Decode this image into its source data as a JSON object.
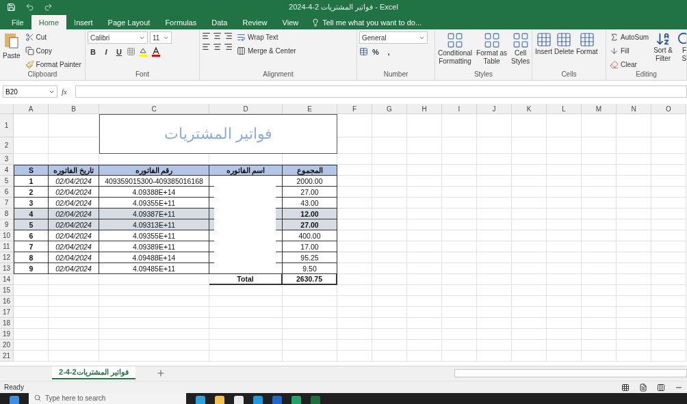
{
  "window": {
    "title": "فواتير المشتريات 2-4-2024 - Excel"
  },
  "tabs": [
    {
      "label": "File",
      "selected": false
    },
    {
      "label": "Home",
      "selected": true
    },
    {
      "label": "Insert",
      "selected": false
    },
    {
      "label": "Page Layout",
      "selected": false
    },
    {
      "label": "Formulas",
      "selected": false
    },
    {
      "label": "Data",
      "selected": false
    },
    {
      "label": "Review",
      "selected": false
    },
    {
      "label": "View",
      "selected": false
    }
  ],
  "tell_me": "Tell me what you want to do...",
  "ribbon": {
    "clipboard": {
      "paste": "Paste",
      "cut": "Cut",
      "copy": "Copy",
      "format_painter": "Format Painter",
      "label": "Clipboard"
    },
    "font": {
      "name": "Calibri",
      "size": "11",
      "bold": "B",
      "italic": "I",
      "underline": "U",
      "label": "Font"
    },
    "alignment": {
      "wrap_text": "Wrap Text",
      "merge_center": "Merge & Center",
      "label": "Alignment"
    },
    "number": {
      "format": "General",
      "percent": "%",
      "comma": ",",
      "label": "Number"
    },
    "styles": {
      "conditional": [
        "Conditional",
        "Formatting"
      ],
      "format_table": [
        "Format as",
        "Table"
      ],
      "cell_styles": [
        "Cell",
        "Styles"
      ],
      "label": "Styles"
    },
    "cells": {
      "insert": "Insert",
      "delete": "Delete",
      "format": "Format",
      "label": "Cells"
    },
    "editing": {
      "autosum": "AutoSum",
      "fill": "Fill",
      "clear": "Clear",
      "sort": [
        "Sort &",
        "Filter"
      ],
      "find": [
        "F",
        "S"
      ],
      "label": "Editing"
    }
  },
  "formula_bar": {
    "name_box": "B20",
    "fx": "fx"
  },
  "sheet": {
    "columns": [
      "A",
      "B",
      "C",
      "D",
      "E",
      "F",
      "G",
      "H",
      "I",
      "J",
      "K",
      "L",
      "M",
      "N",
      "O"
    ],
    "row_numbers": [
      "1",
      "2",
      "3",
      "4",
      "5",
      "6",
      "7",
      "8",
      "9",
      "10",
      "11",
      "12",
      "13",
      "14",
      "15",
      "16",
      "17",
      "18",
      "19",
      "20",
      "21"
    ],
    "title": "فواتير المشتريات",
    "header": {
      "s": "S",
      "date": "تاريخ الفاتوره",
      "number": "رقم الفاتوره",
      "name": "اسم الفاتوره",
      "total": "المجموع"
    },
    "rows": [
      {
        "s": "1",
        "date": "02/04/2024",
        "number": "409359015300-409385016168",
        "total": "2000.00",
        "shaded": false
      },
      {
        "s": "2",
        "date": "02/04/2024",
        "number": "4.09388E+14",
        "total": "27.00",
        "shaded": false
      },
      {
        "s": "3",
        "date": "02/04/2024",
        "number": "4.09355E+11",
        "total": "43.00",
        "shaded": false
      },
      {
        "s": "4",
        "date": "02/04/2024",
        "number": "4.09387E+11",
        "total": "12.00",
        "shaded": true
      },
      {
        "s": "5",
        "date": "02/04/2024",
        "number": "4.09313E+11",
        "total": "27.00",
        "shaded": true
      },
      {
        "s": "6",
        "date": "02/04/2024",
        "number": "4.09355E+11",
        "total": "400.00",
        "shaded": false
      },
      {
        "s": "7",
        "date": "02/04/2024",
        "number": "4.09389E+11",
        "total": "17.00",
        "shaded": false
      },
      {
        "s": "8",
        "date": "02/04/2024",
        "number": "4.09488E+14",
        "total": "95.25",
        "shaded": false
      },
      {
        "s": "9",
        "date": "02/04/2024",
        "number": "4.09485E+11",
        "total": "9.50",
        "shaded": false
      }
    ],
    "total": {
      "label": "Total",
      "value": "2630.75"
    }
  },
  "sheet_tabs": [
    {
      "label": "فواتير المشتريات2-4-2",
      "selected": true
    }
  ],
  "status_bar": {
    "text": "Ready"
  },
  "taskbar": {
    "search_placeholder": "Type here to search"
  }
}
